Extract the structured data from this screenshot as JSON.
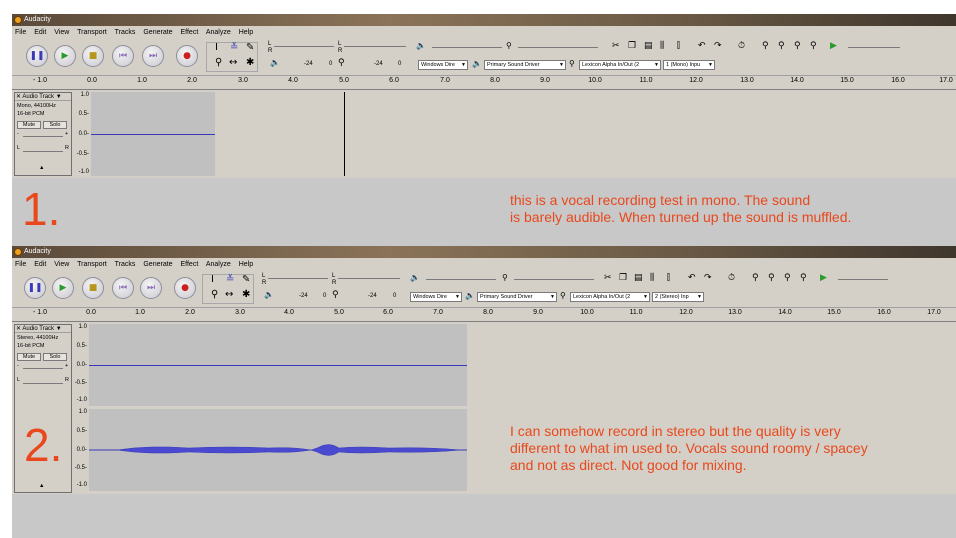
{
  "app": {
    "title": "Audacity"
  },
  "menu": [
    "File",
    "Edit",
    "View",
    "Transport",
    "Tracks",
    "Generate",
    "Effect",
    "Analyze",
    "Help"
  ],
  "meter": {
    "l": "L",
    "r": "R",
    "db1": "-24",
    "zero1": "0",
    "db2": "-24",
    "zero2": "0"
  },
  "ruler_labels": [
    "- 1.0",
    "0.0",
    "1.0",
    "2.0",
    "3.0",
    "4.0",
    "5.0",
    "6.0",
    "7.0",
    "8.0",
    "9.0",
    "10.0",
    "11.0",
    "12.0",
    "13.0",
    "14.0",
    "15.0",
    "16.0",
    "17.0"
  ],
  "scale": {
    "top": "1.0",
    "half": "0.5-",
    "zero": "0.0-",
    "neghalf": "-0.5-",
    "bottom": "-1.0"
  },
  "track": {
    "name": "Audio Track",
    "mute": "Mute",
    "solo": "Solo",
    "pan_l": "L",
    "pan_r": "R",
    "minus": "-",
    "plus": "+"
  },
  "window1": {
    "host": "Windows Dire",
    "output": "Primary Sound Driver",
    "input": "Lexicon Alpha In/Out (2",
    "channels": "1 (Mono) Inpu",
    "track_info": [
      "Mono, 44100Hz",
      "16-bit PCM"
    ],
    "number": "1.",
    "note": "this is a vocal recording test in mono. The sound\nis barely audible. When turned up the sound is muffled."
  },
  "window2": {
    "host": "Windows Dire",
    "output": "Primary Sound Driver",
    "input": "Lexicon Alpha In/Out (2",
    "channels": "2 (Stereo) Inp",
    "track_info": [
      "Stereo, 44100Hz",
      "16-bit PCM"
    ],
    "number": "2.",
    "note": "I can somehow record in stereo but the quality is very\ndifferent to what im used to. Vocals sound roomy / spacey\nand not as direct. Not good for mixing."
  },
  "icons": [
    "pause-icon",
    "play-icon",
    "stop-icon",
    "skip-start-icon",
    "skip-end-icon",
    "record-icon",
    "selection-tool-icon",
    "envelope-tool-icon",
    "draw-tool-icon",
    "zoom-tool-icon",
    "timeshift-tool-icon",
    "multi-tool-icon",
    "speaker-icon",
    "microphone-icon",
    "cut-icon",
    "copy-icon",
    "paste-icon",
    "trim-icon",
    "silence-icon",
    "undo-icon",
    "redo-icon",
    "sync-lock-icon",
    "zoom-in-icon",
    "zoom-out-icon",
    "fit-selection-icon",
    "fit-project-icon",
    "play-at-speed-icon"
  ],
  "colors": {
    "accent_text": "#e8481c",
    "waveform": "#3a3ab8",
    "record": "#cc1f1f",
    "play": "#2a9a2a"
  }
}
